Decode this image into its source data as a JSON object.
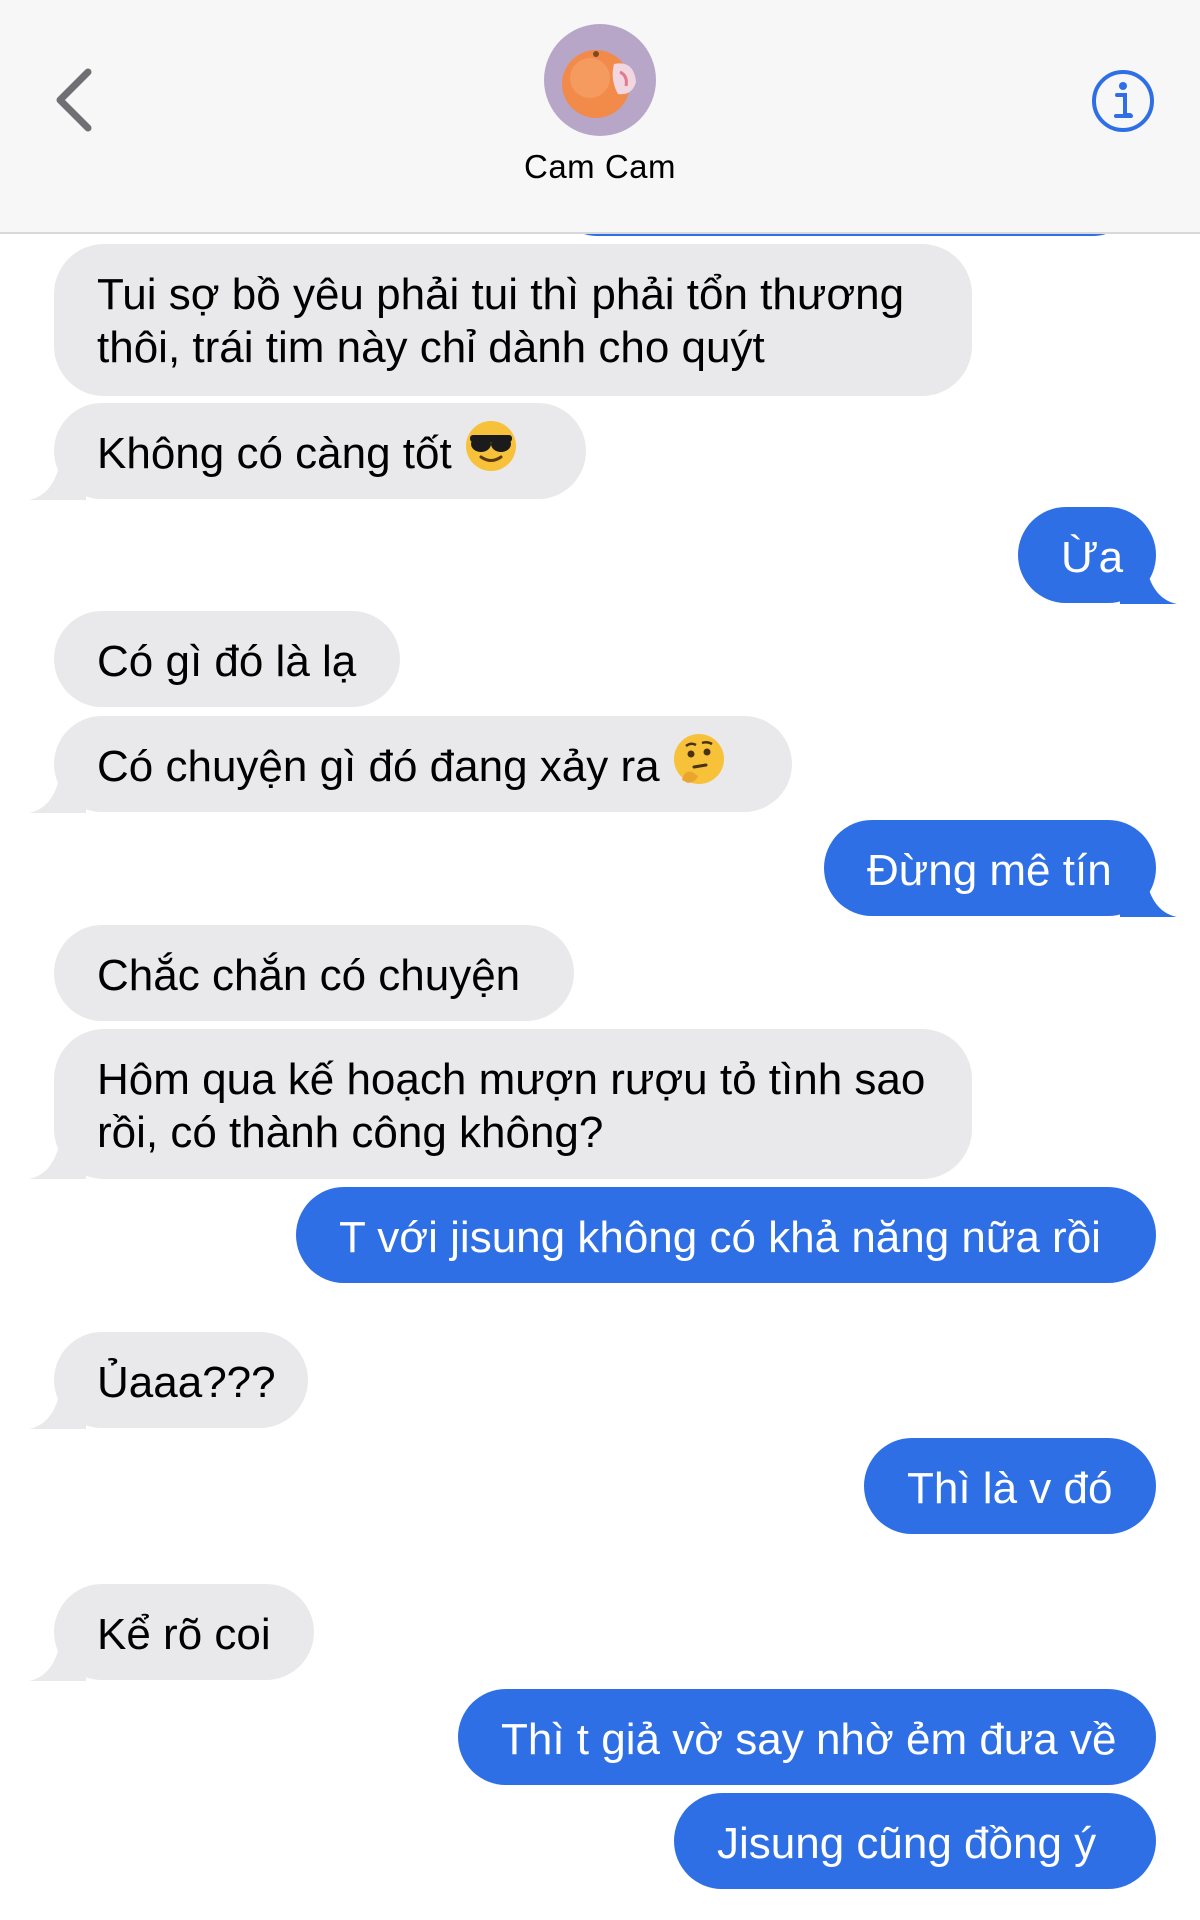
{
  "header": {
    "contact_name": "Cam Cam",
    "back_icon": "chevron-left-icon",
    "info_icon": "info-circle-icon"
  },
  "colors": {
    "outgoing": "#2f6fe6",
    "incoming": "#e9e9eb",
    "accent": "#2f6fe6"
  },
  "messages": [
    {
      "dir": "in",
      "lines": [
        "Tui sợ bồ yêu phải tui thì phải tổn thương",
        "thôi, trái tim này chỉ dành cho quýt"
      ]
    },
    {
      "dir": "in",
      "text": "Không có càng tốt",
      "emoji": "smiling-face-with-sunglasses"
    },
    {
      "dir": "out",
      "text": "Ừa"
    },
    {
      "dir": "in",
      "text": "Có gì đó là lạ"
    },
    {
      "dir": "in",
      "text": "Có chuyện gì đó đang xảy ra",
      "emoji": "thinking-face"
    },
    {
      "dir": "out",
      "text": "Đừng mê tín"
    },
    {
      "dir": "in",
      "text": "Chắc chắn có chuyện"
    },
    {
      "dir": "in",
      "lines": [
        "Hôm qua kế hoạch mượn rượu tỏ tình sao",
        "rồi, có thành công không?"
      ]
    },
    {
      "dir": "out",
      "text": "T với jisung không có khả năng nữa rồi"
    },
    {
      "dir": "in",
      "text": "Ủaaa???"
    },
    {
      "dir": "out",
      "text": "Thì là v đó"
    },
    {
      "dir": "in",
      "text": "Kể rõ coi"
    },
    {
      "dir": "out",
      "text": "Thì t giả vờ say nhờ ẻm đưa về"
    },
    {
      "dir": "out",
      "text": "Jisung cũng đồng ý"
    }
  ]
}
